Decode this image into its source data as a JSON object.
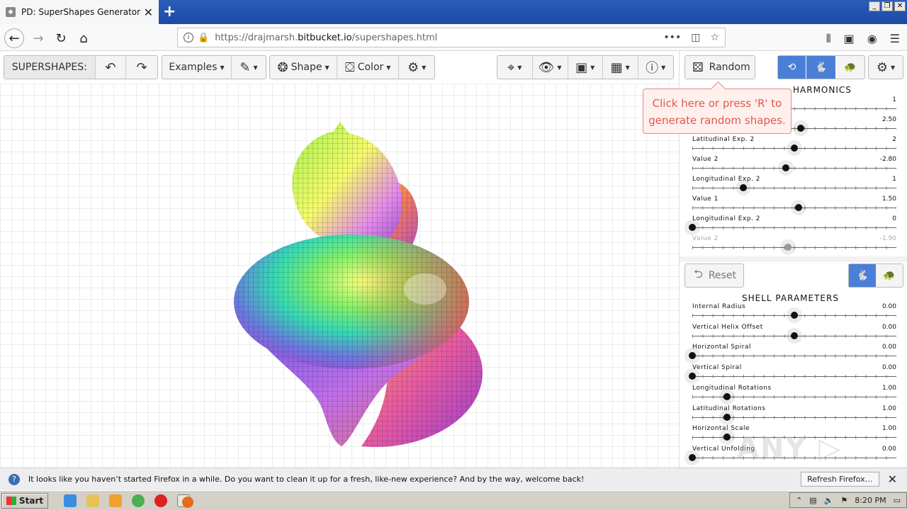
{
  "browser": {
    "tab_title": "PD: SuperShapes Generator",
    "url_prefix": "https://drajmarsh.",
    "url_host": "bitbucket.io",
    "url_path": "/supershapes.html"
  },
  "toolbar": {
    "app_label": "SUPERSHAPES:",
    "examples_label": "Examples",
    "shape_label": "Shape",
    "color_label": "Color",
    "random_label": "Random"
  },
  "tooltip": {
    "line1": "Click here or press 'R' to",
    "line2": "generate random shapes."
  },
  "harmonics": {
    "title": "HARMONICS",
    "sliders": [
      {
        "label": "",
        "value": "1",
        "pos": 0.0
      },
      {
        "label": "",
        "value": "2.50",
        "pos": 0.53
      },
      {
        "label": "Latitudinal Exp. 2",
        "value": "2",
        "pos": 0.5
      },
      {
        "label": "Value 2",
        "value": "-2.80",
        "pos": 0.46
      },
      {
        "label": "Longitudinal Exp. 2",
        "value": "1",
        "pos": 0.25
      },
      {
        "label": "Value 1",
        "value": "1.50",
        "pos": 0.52
      },
      {
        "label": "Longitudinal Exp. 2",
        "value": "0",
        "pos": 0.0
      },
      {
        "label": "Value 2",
        "value": "-1.90",
        "pos": 0.47
      }
    ]
  },
  "shell": {
    "reset_label": "Reset",
    "title": "SHELL PARAMETERS",
    "sliders": [
      {
        "label": "Internal Radius",
        "value": "0.00",
        "pos": 0.5
      },
      {
        "label": "Vertical Helix Offset",
        "value": "0.00",
        "pos": 0.5
      },
      {
        "label": "Horizontal Spiral",
        "value": "0.00",
        "pos": 0.0
      },
      {
        "label": "Vertical Spiral",
        "value": "0.00",
        "pos": 0.0
      },
      {
        "label": "Longitudinal Rotations",
        "value": "1.00",
        "pos": 0.17
      },
      {
        "label": "Latitudinal Rotations",
        "value": "1.00",
        "pos": 0.17
      },
      {
        "label": "Horizontal Scale",
        "value": "1.00",
        "pos": 0.17
      },
      {
        "label": "Vertical Unfolding",
        "value": "0.00",
        "pos": 0.0
      }
    ]
  },
  "notification": {
    "message": "It looks like you haven’t started Firefox in a while. Do you want to clean it up for a fresh, like-new experience? And by the way, welcome back!",
    "button": "Refresh Firefox…"
  },
  "taskbar": {
    "start_label": "Start",
    "clock": "8:20 PM"
  },
  "watermark": "ANY RUN"
}
